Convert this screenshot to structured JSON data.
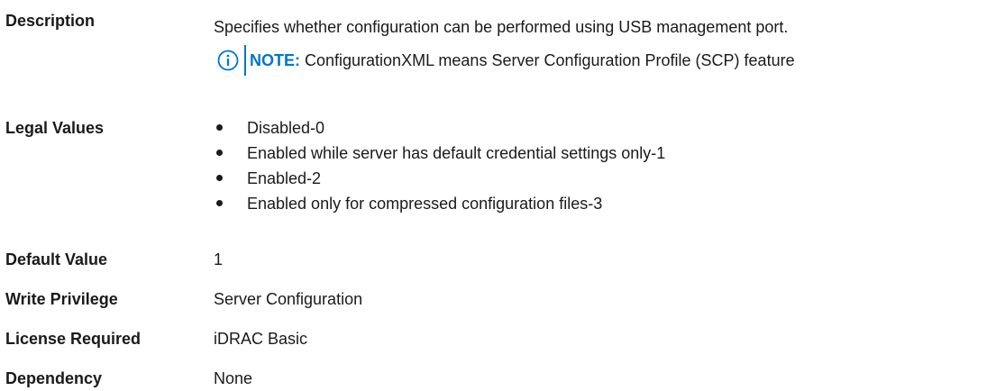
{
  "description": {
    "label": "Description",
    "text": "Specifies whether configuration can be performed using USB management port.",
    "note": {
      "label": "NOTE:",
      "text": "ConfigurationXML means Server Configuration Profile (SCP) feature",
      "icon": "info-icon",
      "accent": "#0076ce"
    }
  },
  "legal_values": {
    "label": "Legal Values",
    "items": [
      "Disabled-0",
      "Enabled while server has default credential settings only-1",
      "Enabled-2",
      "Enabled only for compressed configuration files-3"
    ]
  },
  "default_value": {
    "label": "Default Value",
    "value": "1"
  },
  "write_privilege": {
    "label": "Write Privilege",
    "value": "Server Configuration"
  },
  "license_required": {
    "label": "License Required",
    "value": "iDRAC Basic"
  },
  "dependency": {
    "label": "Dependency",
    "value": "None"
  }
}
